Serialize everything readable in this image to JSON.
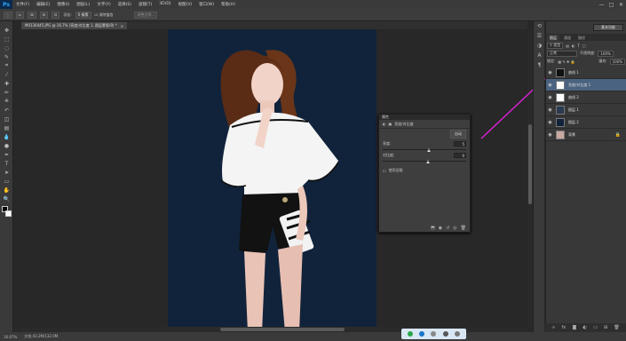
{
  "app": {
    "logo": "Ps"
  },
  "menu": [
    "文件(F)",
    "编辑(E)",
    "图像(I)",
    "图层(L)",
    "文字(Y)",
    "选择(S)",
    "滤镜(T)",
    "3D(D)",
    "视图(V)",
    "窗口(W)",
    "帮助(H)"
  ],
  "window_controls": [
    "—",
    "□",
    "✕"
  ],
  "options": {
    "feather_label": "羽化:",
    "feather_value": "0 像素",
    "antialias_label": "消除锯齿",
    "refine_label": "调整边缘..."
  },
  "doc_tab": {
    "title": "M0136445.JPG @ 16.7% (亮度/对比度 1, 图层蒙版/8) *",
    "close": "×"
  },
  "tools": [
    "icon-move",
    "icon-marquee",
    "icon-lasso",
    "icon-quick-select",
    "icon-crop",
    "icon-eyedropper",
    "icon-healing",
    "icon-brush",
    "icon-stamp",
    "icon-history-brush",
    "icon-eraser",
    "icon-gradient",
    "icon-blur",
    "icon-dodge",
    "icon-pen",
    "icon-type",
    "icon-path-select",
    "icon-shape",
    "icon-hand",
    "icon-zoom"
  ],
  "status": {
    "zoom": "16.67%",
    "doc": "文档:43.2M/132.0M"
  },
  "properties": {
    "title": "属性",
    "subtitle": "亮度/对比度",
    "auto_button": "自动",
    "brightness_label": "亮度:",
    "brightness_value": "5",
    "contrast_label": "对比度:",
    "contrast_value": "0",
    "legacy_label": "使用旧版",
    "brightness_level": 0.51,
    "contrast_level": 0.5
  },
  "panel": {
    "workspace": "基本功能",
    "tabs": [
      "图层",
      "通道",
      "路径"
    ],
    "kind_label": "正常",
    "opacity_label": "不透明度:",
    "opacity_value": "100%",
    "lock_label": "锁定:",
    "fill_label": "填充:",
    "fill_value": "100%"
  },
  "layers": [
    {
      "name": "曲线 1",
      "thumb": "#111111",
      "visible": true,
      "selected": false
    },
    {
      "name": "亮度/对比度 1",
      "thumb": "#ffffff",
      "visible": true,
      "selected": true
    },
    {
      "name": "曲线 2",
      "thumb": "#ffffff",
      "visible": true,
      "selected": false
    },
    {
      "name": "图层 1",
      "thumb": "#2a3a50",
      "visible": true,
      "selected": false
    },
    {
      "name": "图层 2",
      "thumb": "#11233b",
      "visible": true,
      "selected": false
    },
    {
      "name": "背景",
      "thumb": "#c8a9a0",
      "visible": true,
      "selected": false,
      "locked": true
    }
  ],
  "colors": {
    "arrow": "#e020d8",
    "selected_layer": "#4a6380",
    "canvas_bg": "#11233b"
  }
}
